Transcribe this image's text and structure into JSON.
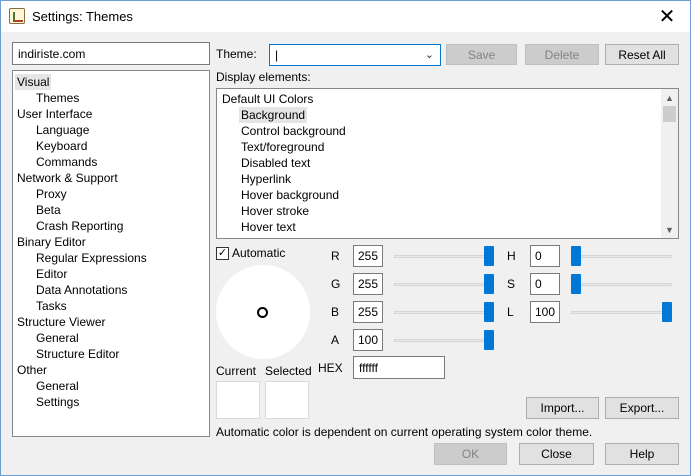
{
  "window": {
    "title": "Settings: Themes",
    "close_glyph": "✕"
  },
  "search": {
    "value": "indiriste.com"
  },
  "tree": {
    "items": [
      {
        "label": "Visual",
        "level": 0,
        "selected": true
      },
      {
        "label": "Themes",
        "level": 1
      },
      {
        "label": "User Interface",
        "level": 0
      },
      {
        "label": "Language",
        "level": 1
      },
      {
        "label": "Keyboard",
        "level": 1
      },
      {
        "label": "Commands",
        "level": 1
      },
      {
        "label": "Network & Support",
        "level": 0
      },
      {
        "label": "Proxy",
        "level": 1
      },
      {
        "label": "Beta",
        "level": 1
      },
      {
        "label": "Crash Reporting",
        "level": 1
      },
      {
        "label": "Binary Editor",
        "level": 0
      },
      {
        "label": "Regular Expressions",
        "level": 1
      },
      {
        "label": "Editor",
        "level": 1
      },
      {
        "label": "Data Annotations",
        "level": 1
      },
      {
        "label": "Tasks",
        "level": 1
      },
      {
        "label": "Structure Viewer",
        "level": 0
      },
      {
        "label": "General",
        "level": 1
      },
      {
        "label": "Structure Editor",
        "level": 1
      },
      {
        "label": "Other",
        "level": 0
      },
      {
        "label": "General",
        "level": 1
      },
      {
        "label": "Settings",
        "level": 1
      }
    ]
  },
  "theme": {
    "label": "Theme:",
    "value": "|",
    "save_label": "Save",
    "delete_label": "Delete",
    "reset_label": "Reset All"
  },
  "display": {
    "label": "Display elements:",
    "items": [
      {
        "label": "Default UI Colors",
        "level": 0
      },
      {
        "label": "Background",
        "level": 1,
        "selected": true
      },
      {
        "label": "Control background",
        "level": 1
      },
      {
        "label": "Text/foreground",
        "level": 1
      },
      {
        "label": "Disabled text",
        "level": 1
      },
      {
        "label": "Hyperlink",
        "level": 1
      },
      {
        "label": "Hover background",
        "level": 1
      },
      {
        "label": "Hover stroke",
        "level": 1
      },
      {
        "label": "Hover text",
        "level": 1
      }
    ]
  },
  "color": {
    "automatic_label": "Automatic",
    "automatic_checked": true,
    "channels": [
      {
        "key": "R",
        "value": "255",
        "fraction": 1.0
      },
      {
        "key": "G",
        "value": "255",
        "fraction": 1.0
      },
      {
        "key": "B",
        "value": "255",
        "fraction": 1.0
      },
      {
        "key": "A",
        "value": "100",
        "fraction": 1.0
      }
    ],
    "hsl": [
      {
        "key": "H",
        "value": "0",
        "fraction": 0.0
      },
      {
        "key": "S",
        "value": "0",
        "fraction": 0.0
      },
      {
        "key": "L",
        "value": "100",
        "fraction": 1.0
      }
    ],
    "hex_label": "HEX",
    "hex_value": "ffffff",
    "current_label": "Current",
    "selected_label": "Selected",
    "current_color": "#ffffff",
    "selected_color": "#ffffff",
    "slider_color": "#0078d7"
  },
  "import_label": "Import...",
  "export_label": "Export...",
  "note": "Automatic color is dependent on current operating system color theme.",
  "footer": {
    "ok_label": "OK",
    "close_label": "Close",
    "help_label": "Help"
  }
}
